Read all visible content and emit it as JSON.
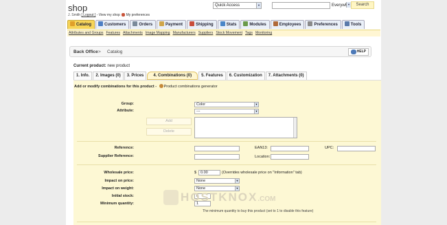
{
  "header": {
    "shop_title": "shop",
    "user_name": "J. Smith",
    "logout": "[ Logout ]",
    "view_shop": "View my shop",
    "sep": " - ",
    "my_preferences": "My preferences",
    "quick_access": "Quick Access",
    "search_scope": "Everywhere",
    "search_button": "Search"
  },
  "main_tabs": [
    {
      "label": "Catalog",
      "color": "#e0a02a",
      "active": true
    },
    {
      "label": "Customers",
      "color": "#4e7fc4"
    },
    {
      "label": "Orders",
      "color": "#7a8a9a"
    },
    {
      "label": "Payment",
      "color": "#d0a64a"
    },
    {
      "label": "Shipping",
      "color": "#c94d3a"
    },
    {
      "label": "Stats",
      "color": "#4a86c8"
    },
    {
      "label": "Modules",
      "color": "#6a9a4a"
    },
    {
      "label": "Employees",
      "color": "#b06a3a"
    },
    {
      "label": "Preferences",
      "color": "#8a8a8a"
    },
    {
      "label": "Tools",
      "color": "#5a7aaa"
    }
  ],
  "sub_tabs": [
    "Attributes and Groups",
    "Features",
    "Attachments",
    "Image Mapping",
    "Manufacturers",
    "Suppliers",
    "Stock Movement",
    "Tags",
    "Monitoring"
  ],
  "backoffice": {
    "label": "Back Office",
    "sep": ">",
    "crumb": "Catalog",
    "help": "HELP"
  },
  "product": {
    "current_label": "Current product:",
    "current_value": "new product"
  },
  "product_tabs": [
    "1. Info.",
    "2. Images (0)",
    "3. Prices",
    "4. Combinations (0)",
    "5. Features",
    "6. Customization",
    "7. Attachments (0)"
  ],
  "form": {
    "heading": "Add or modify combinations for this product",
    "heading_sep": " - ",
    "generator": "Product combinations generator",
    "group_label": "Group:",
    "group_value": "Color",
    "attribute_label": "Attribute:",
    "attribute_value": "---",
    "add_button": "Add",
    "delete_button": "Delete",
    "reference_label": "Reference:",
    "ean_label": "EAN13:",
    "upc_label": "UPC:",
    "supplier_ref_label": "Supplier Reference:",
    "location_label": "Location:",
    "wholesale_label": "Wholesale price:",
    "currency": "$",
    "wholesale_value": "0.00",
    "wholesale_note": "(Overrides wholesale price on \"Information\" tab)",
    "impact_price_label": "Impact on price:",
    "impact_price_value": "None",
    "impact_weight_label": "Impact on weight:",
    "impact_weight_value": "None",
    "initial_stock_label": "Initial stock:",
    "initial_stock_value": "0",
    "min_qty_label": "Minimum quantity:",
    "min_qty_value": "1",
    "min_qty_note": "The minimum quantity to buy this product (set to 1 to disable this feature)"
  },
  "watermark": {
    "text": "HOSTKNOX",
    "suffix": ".COM"
  }
}
